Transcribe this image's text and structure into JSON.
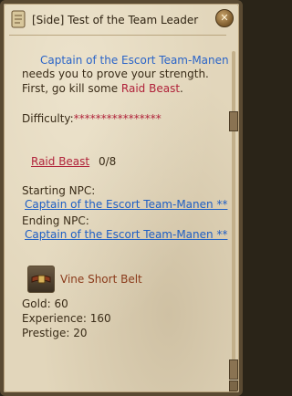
{
  "header": {
    "title": "[Side] Test of the Team Leader"
  },
  "quest": {
    "giver_name": "Captain of the Escort Team-Manen",
    "line1_rest": "needs you to prove your strength.",
    "line2_prefix": "First, go kill some ",
    "target_link": "Raid Beast",
    "line2_suffix": ".",
    "difficulty_label": "Difficulty:",
    "difficulty_stars": "****************",
    "objective_name": "Raid Beast",
    "objective_progress": "0/8",
    "starting_label": "Starting NPC:",
    "starting_npc": "Captain of the Escort Team-Manen **",
    "ending_label": "Ending NPC:",
    "ending_npc": "Captain of the Escort Team-Manen **"
  },
  "reward": {
    "item_name": "Vine  Short  Belt",
    "gold": "Gold: 60",
    "experience": "Experience: 160",
    "prestige": "Prestige: 20"
  },
  "colors": {
    "link": "#2a64c8",
    "enemy": "#b0223a",
    "text": "#3a2c18"
  },
  "icons": [
    "quest-scroll-icon",
    "close-icon",
    "belt-icon"
  ]
}
